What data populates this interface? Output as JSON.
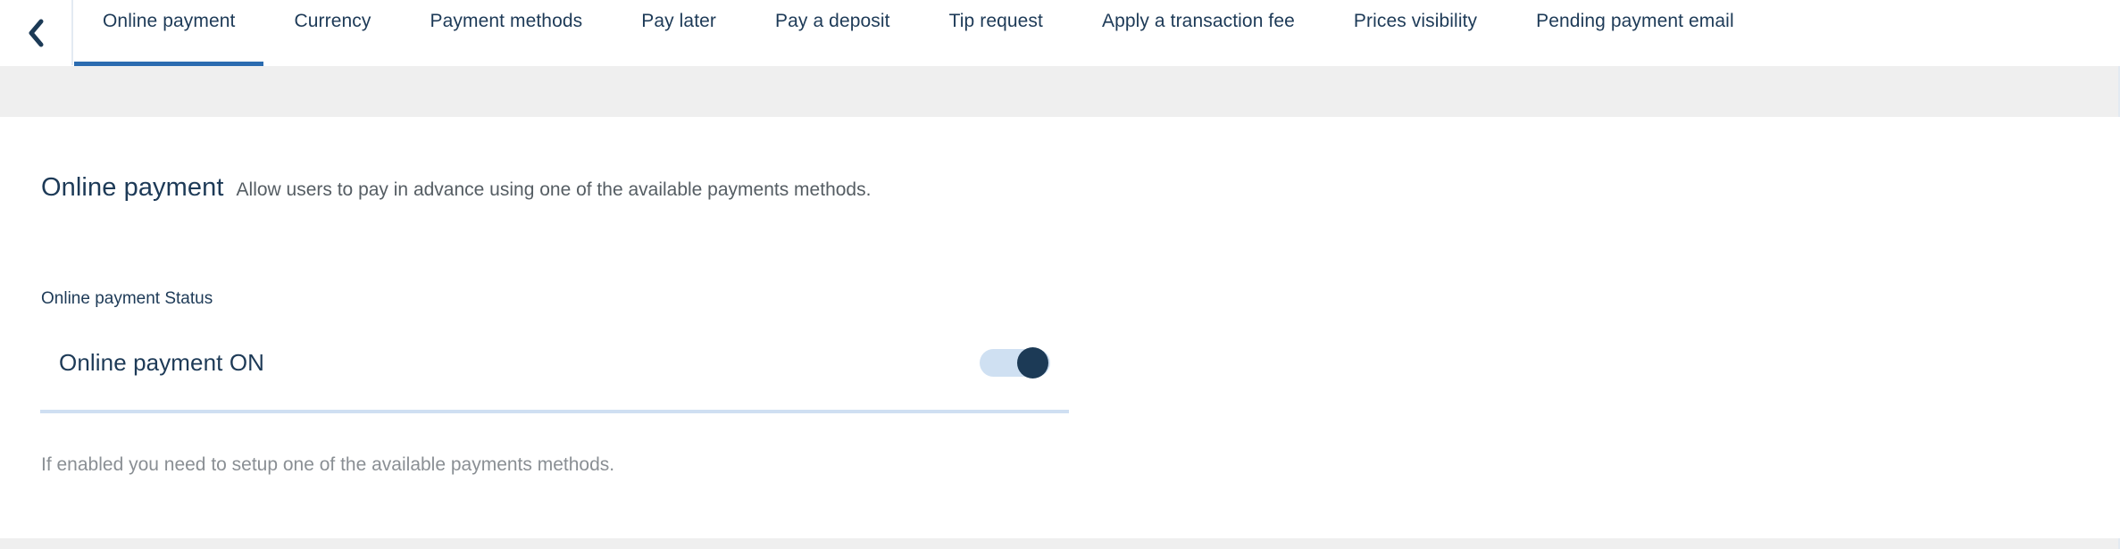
{
  "header": {
    "back_icon": "chevron-left-icon",
    "tabs": [
      {
        "label": "Online payment",
        "active": true
      },
      {
        "label": "Currency",
        "active": false
      },
      {
        "label": "Payment methods",
        "active": false
      },
      {
        "label": "Pay later",
        "active": false
      },
      {
        "label": "Pay a deposit",
        "active": false
      },
      {
        "label": "Tip request",
        "active": false
      },
      {
        "label": "Apply a transaction fee",
        "active": false
      },
      {
        "label": "Prices visibility",
        "active": false
      },
      {
        "label": "Pending payment email",
        "active": false
      }
    ]
  },
  "main": {
    "title": "Online payment",
    "description": "Allow users to pay in advance using one of the available payments methods.",
    "section_label": "Online payment Status",
    "toggle": {
      "label": "Online payment ON",
      "state": "on"
    },
    "hint": "If enabled you need to setup one of the available payments methods."
  },
  "colors": {
    "accent": "#2b6cb0",
    "navy": "#1d3a57",
    "toggle_track": "#cfe0f2",
    "toggle_knob": "#1c3a56",
    "band": "#efefef",
    "divider": "#cfdff2",
    "muted_text": "#8a8f94"
  }
}
